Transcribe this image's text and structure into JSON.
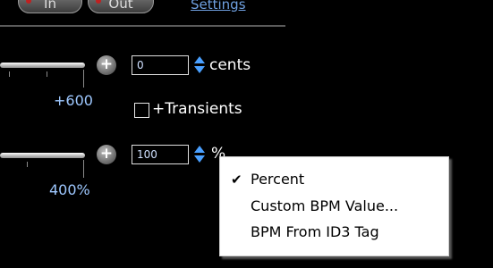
{
  "toolbar": {
    "in_label": "In",
    "out_label": "Out",
    "settings_label": "Settings"
  },
  "pitch": {
    "value": "0",
    "unit": "cents",
    "scale_label": "+600",
    "transients_label": "+Transients"
  },
  "tempo": {
    "value": "100",
    "unit": "%",
    "scale_label": "400%"
  },
  "menu": {
    "items": [
      {
        "label": "Percent",
        "checked": true
      },
      {
        "label": "Custom BPM Value...",
        "checked": false
      },
      {
        "label": "BPM From ID3 Tag",
        "checked": false
      }
    ]
  },
  "colors": {
    "background": "#000000",
    "link": "#6fa0e0",
    "scale_text": "#9ec8ff",
    "spinner": "#4aa0ff"
  }
}
